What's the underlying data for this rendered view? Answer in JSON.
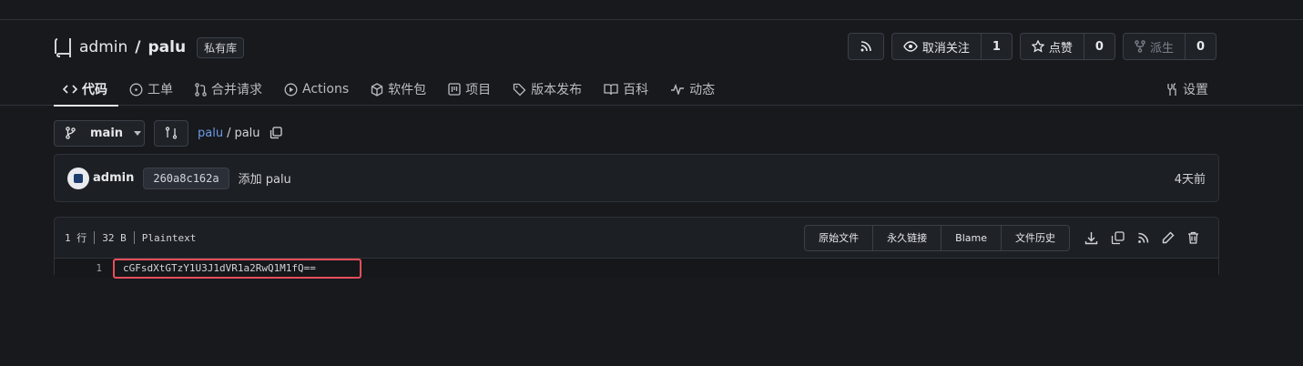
{
  "repo": {
    "owner": "admin",
    "separator": "/",
    "name": "palu",
    "visibility_badge": "私有库"
  },
  "actions": {
    "rss_icon": "rss-icon",
    "unwatch_label": "取消关注",
    "unwatch_count": "1",
    "star_label": "点赞",
    "star_count": "0",
    "fork_label": "派生",
    "fork_count": "0"
  },
  "tabs": [
    {
      "label": "代码",
      "icon": "code-icon",
      "active": true
    },
    {
      "label": "工单",
      "icon": "issue-icon"
    },
    {
      "label": "合并请求",
      "icon": "pull-request-icon"
    },
    {
      "label": "Actions",
      "icon": "play-icon"
    },
    {
      "label": "软件包",
      "icon": "package-icon"
    },
    {
      "label": "项目",
      "icon": "project-icon"
    },
    {
      "label": "版本发布",
      "icon": "tag-icon"
    },
    {
      "label": "百科",
      "icon": "book-icon"
    },
    {
      "label": "动态",
      "icon": "pulse-icon"
    }
  ],
  "settings_label": "设置",
  "branch": {
    "name": "main"
  },
  "breadcrumb": {
    "repo": "palu",
    "sep": "/",
    "file": "palu"
  },
  "commit": {
    "author": "admin",
    "sha": "260a8c162a",
    "message": "添加 palu",
    "time": "4天前"
  },
  "file": {
    "lines": "1 行",
    "size": "32 B",
    "type": "Plaintext",
    "buttons": [
      "原始文件",
      "永久链接",
      "Blame",
      "文件历史"
    ],
    "line_number": "1",
    "content": "cGFsdXtGTzY1U3J1dVR1a2RwQ1M1fQ=="
  },
  "colors": {
    "highlight": "#e84e5a",
    "link": "#6b9be6"
  }
}
